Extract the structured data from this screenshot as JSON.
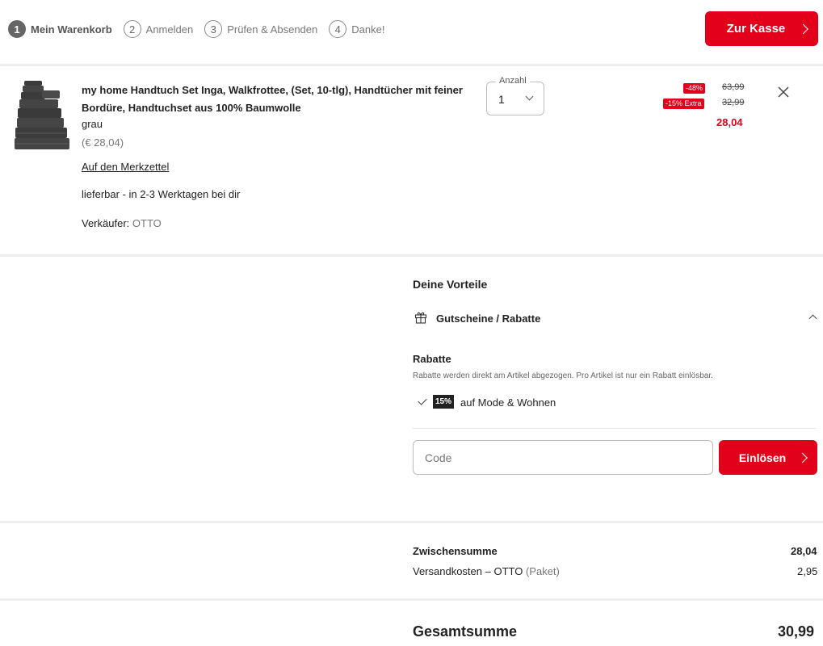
{
  "steps": [
    {
      "num": "1",
      "label": "Mein Warenkorb"
    },
    {
      "num": "2",
      "label": "Anmelden"
    },
    {
      "num": "3",
      "label": "Prüfen & Absenden"
    },
    {
      "num": "4",
      "label": "Danke!"
    }
  ],
  "header": {
    "checkout_label": "Zur Kasse"
  },
  "product": {
    "title": "my home Handtuch Set Inga, Walkfrottee, (Set, 10-tlg), Handtücher mit feiner Bordüre, Handtuchset aus 100% Baumwolle",
    "color": "grau",
    "unit_price": "(€ 28,04)",
    "wishlist_link": "Auf den Merkzettel",
    "delivery": "lieferbar - in 2-3 Werktagen bei dir",
    "seller_label": "Verkäufer:",
    "seller_value": "OTTO",
    "quantity_label": "Anzahl",
    "quantity_value": "1",
    "discount_badge": "-48%",
    "extra_badge": "-15% Extra",
    "original_price": "63,99",
    "reduced_price": "32,99",
    "final_price": "28,04"
  },
  "benefits": {
    "title": "Deine Vorteile",
    "voucher_label": "Gutscheine / Rabatte",
    "rabatte_title": "Rabatte",
    "rabatte_desc": "Rabatte werden direkt am Artikel abgezogen. Pro Artikel ist nur ein Rabatt einlösbar.",
    "discount_badge": "15%",
    "discount_text": "auf Mode & Wohnen",
    "code_placeholder": "Code",
    "redeem_label": "Einlösen"
  },
  "summary": {
    "subtotal_label": "Zwischensumme",
    "subtotal_value": "28,04",
    "shipping_label": "Versandkosten – OTTO",
    "shipping_note": "(Paket)",
    "shipping_value": "2,95",
    "total_label": "Gesamtsumme",
    "total_value": "30,99"
  },
  "colors": {
    "accent": "#e2001a",
    "divider": "#eeeeee"
  }
}
